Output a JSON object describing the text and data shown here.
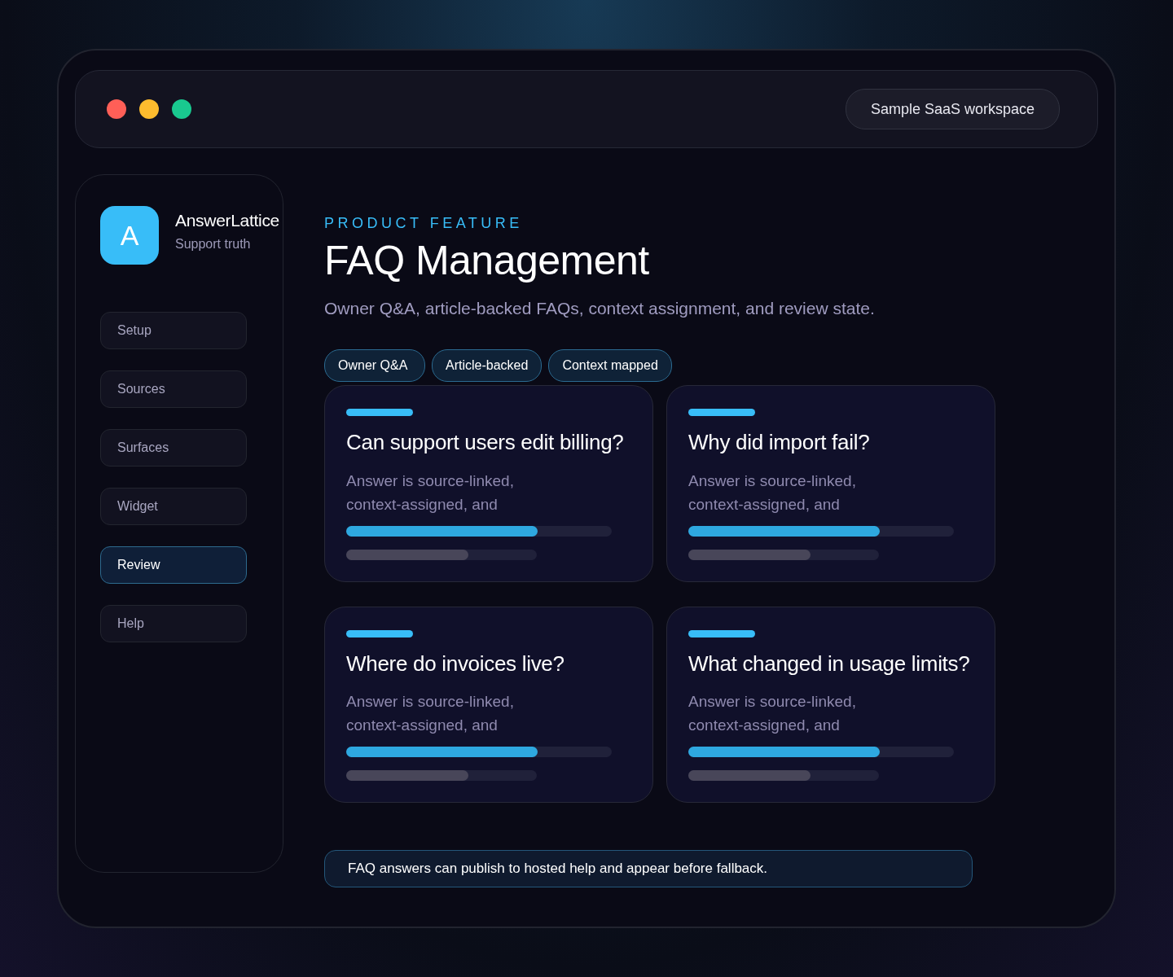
{
  "window": {
    "controls": [
      {
        "color": "#ff5f57"
      },
      {
        "color": "#febc2e"
      },
      {
        "color": "#19c98f"
      }
    ],
    "workspace": "Sample SaaS workspace"
  },
  "brand": {
    "logo": "A",
    "name": "AnswerLattice",
    "tagline": "Support truth"
  },
  "nav": [
    {
      "label": "Setup",
      "selected": false
    },
    {
      "label": "Sources",
      "selected": false
    },
    {
      "label": "Surfaces",
      "selected": false
    },
    {
      "label": "Widget",
      "selected": false
    },
    {
      "label": "Review",
      "selected": true
    },
    {
      "label": "Help",
      "selected": false
    }
  ],
  "eyebrow": "PRODUCT FEATURE",
  "title": "FAQ Management",
  "subtitle": "Owner Q&A, article-backed FAQs, context assignment, and review state.",
  "tags": [
    "Owner Q&A",
    "Article-backed",
    "Context mapped"
  ],
  "cards": [
    {
      "question": "Can support users edit billing?",
      "answer": "Answer is source-linked, context-assigned, and",
      "primary": {
        "level": 0.72
      },
      "secondary": {
        "level": 0.64
      }
    },
    {
      "question": "Why did import fail?",
      "answer": "Answer is source-linked, context-assigned, and",
      "primary": {
        "level": 0.72
      },
      "secondary": {
        "level": 0.64
      }
    },
    {
      "question": "Where do invoices live?",
      "answer": "Answer is source-linked, context-assigned, and",
      "primary": {
        "level": 0.72
      },
      "secondary": {
        "level": 0.64
      }
    },
    {
      "question": "What changed in usage limits?",
      "answer": "Answer is source-linked, context-assigned, and",
      "primary": {
        "level": 0.72
      },
      "secondary": {
        "level": 0.64
      }
    }
  ],
  "notice": "FAQ answers can publish to hosted help and appear before fallback."
}
